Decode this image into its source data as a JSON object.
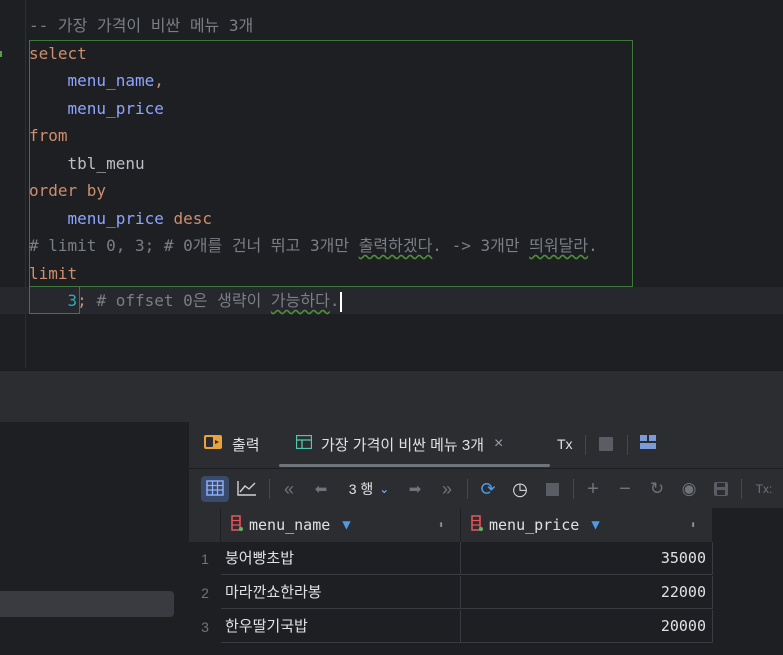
{
  "editor": {
    "lines": {
      "l1": "-- 가장 가격이 비싼 메뉴 3개",
      "l2": "select",
      "l3": "menu_name",
      "l3b": ",",
      "l4": "menu_price",
      "l5": "from",
      "l6": "tbl_menu",
      "l7a": "order by",
      "l8a": "menu_price",
      "l8b": "desc",
      "l9a": "# limit 0, 3; # 0개를 건너 뛰고 3개만 ",
      "l9b": "출력하겠다",
      "l9c": ". -> 3개만 ",
      "l9d": "띄워달라",
      "l9e": ".",
      "l10": "limit",
      "l11a": "3",
      "l11b": ";",
      "l11c": " # offset 0은 생략이 ",
      "l11d": "가능하다",
      "l11e": "."
    }
  },
  "results": {
    "tabs": {
      "output_label": "출력",
      "result_label": "가장 가격이 비싼 메뉴 3개",
      "tx_label": "Tx"
    },
    "toolbar": {
      "rows_label": "3 행",
      "tx_label": "Tx:"
    },
    "columns": {
      "c1": "menu_name",
      "c2": "menu_price"
    },
    "rows": [
      {
        "n": "1",
        "name": "붕어빵초밥",
        "price": "35000"
      },
      {
        "n": "2",
        "name": "마라깐쇼한라봉",
        "price": "22000"
      },
      {
        "n": "3",
        "name": "한우딸기국밥",
        "price": "20000"
      }
    ]
  },
  "colors": {
    "keyword": "#cf8e6d",
    "identifier": "#8fa5ff",
    "comment": "#7a7e85",
    "accent": "#3574f0"
  }
}
